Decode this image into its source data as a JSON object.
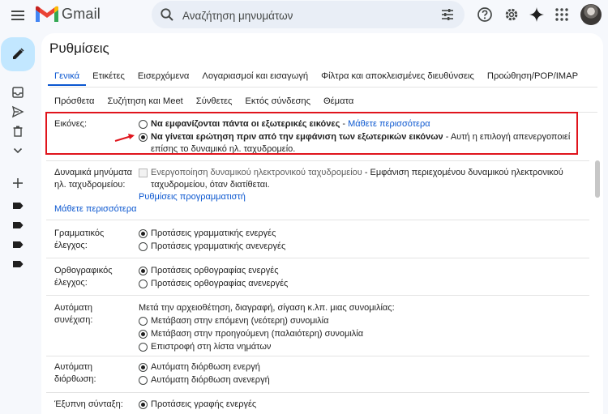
{
  "app": {
    "name": "Gmail"
  },
  "search": {
    "placeholder": "Αναζήτηση μηνυμάτων"
  },
  "page": {
    "title": "Ρυθμίσεις"
  },
  "tabs_row1": [
    {
      "label": "Γενικά",
      "active": true
    },
    {
      "label": "Ετικέτες"
    },
    {
      "label": "Εισερχόμενα"
    },
    {
      "label": "Λογαριασμοί και εισαγωγή"
    },
    {
      "label": "Φίλτρα και αποκλεισμένες διευθύνσεις"
    },
    {
      "label": "Προώθηση/POP/IMAP"
    }
  ],
  "tabs_row2": [
    {
      "label": "Πρόσθετα"
    },
    {
      "label": "Συζήτηση και Meet"
    },
    {
      "label": "Σύνθετες"
    },
    {
      "label": "Εκτός σύνδεσης"
    },
    {
      "label": "Θέματα"
    }
  ],
  "images": {
    "label": "Εικόνες:",
    "opt1": "Να εμφανίζονται πάντα οι εξωτερικές εικόνες",
    "opt1_sep": " - ",
    "opt1_link": "Μάθετε περισσότερα",
    "opt2": "Να γίνεται ερώτηση πριν από την εμφάνιση των εξωτερικών εικόνων",
    "opt2_note": " - Αυτή η επιλογή απενεργοποιεί επίσης το δυναμικό ηλ. ταχυδρομείο.",
    "selected": 2
  },
  "dynamic": {
    "label": "Δυναμικά μηνύματα ηλ. ταχυδρομείου:",
    "checkbox": "Ενεργοποίηση δυναμικού ηλεκτρονικού ταχυδρομείου",
    "desc": " - Εμφάνιση περιεχομένου δυναμικού ηλεκτρονικού ταχυδρομείου, όταν διατίθεται.",
    "dev_link": "Ρυθμίσεις προγραμματιστή",
    "learn_link": "Μάθετε περισσότερα"
  },
  "grammar": {
    "label": "Γραμματικός έλεγχος:",
    "on": "Προτάσεις γραμματικής ενεργές",
    "off": "Προτάσεις γραμματικής ανενεργές"
  },
  "spelling": {
    "label": "Ορθογραφικός έλεγχος:",
    "on": "Προτάσεις ορθογραφίας ενεργές",
    "off": "Προτάσεις ορθογραφίας ανενεργές"
  },
  "autoadvance": {
    "label": "Αυτόματη συνέχιση:",
    "intro": "Μετά την αρχειοθέτηση, διαγραφή, σίγαση κ.λπ. μιας συνομιλίας:",
    "next": "Μετάβαση στην επόμενη (νεότερη) συνομιλία",
    "prev": "Μετάβαση στην προηγούμενη (παλαιότερη) συνομιλία",
    "list": "Επιστροφή στη λίστα νημάτων"
  },
  "autocorrect": {
    "label": "Αυτόματη διόρθωση:",
    "on": "Αυτόματη διόρθωση ενεργή",
    "off": "Αυτόματη διόρθωση ανενεργή"
  },
  "smart_compose": {
    "label": "Έξυπνη σύνταξη:",
    "on": "Προτάσεις γραφής ενεργές"
  },
  "colors": {
    "accent": "#0b57d0",
    "highlight": "#e0141c",
    "compose": "#c2e7ff"
  }
}
